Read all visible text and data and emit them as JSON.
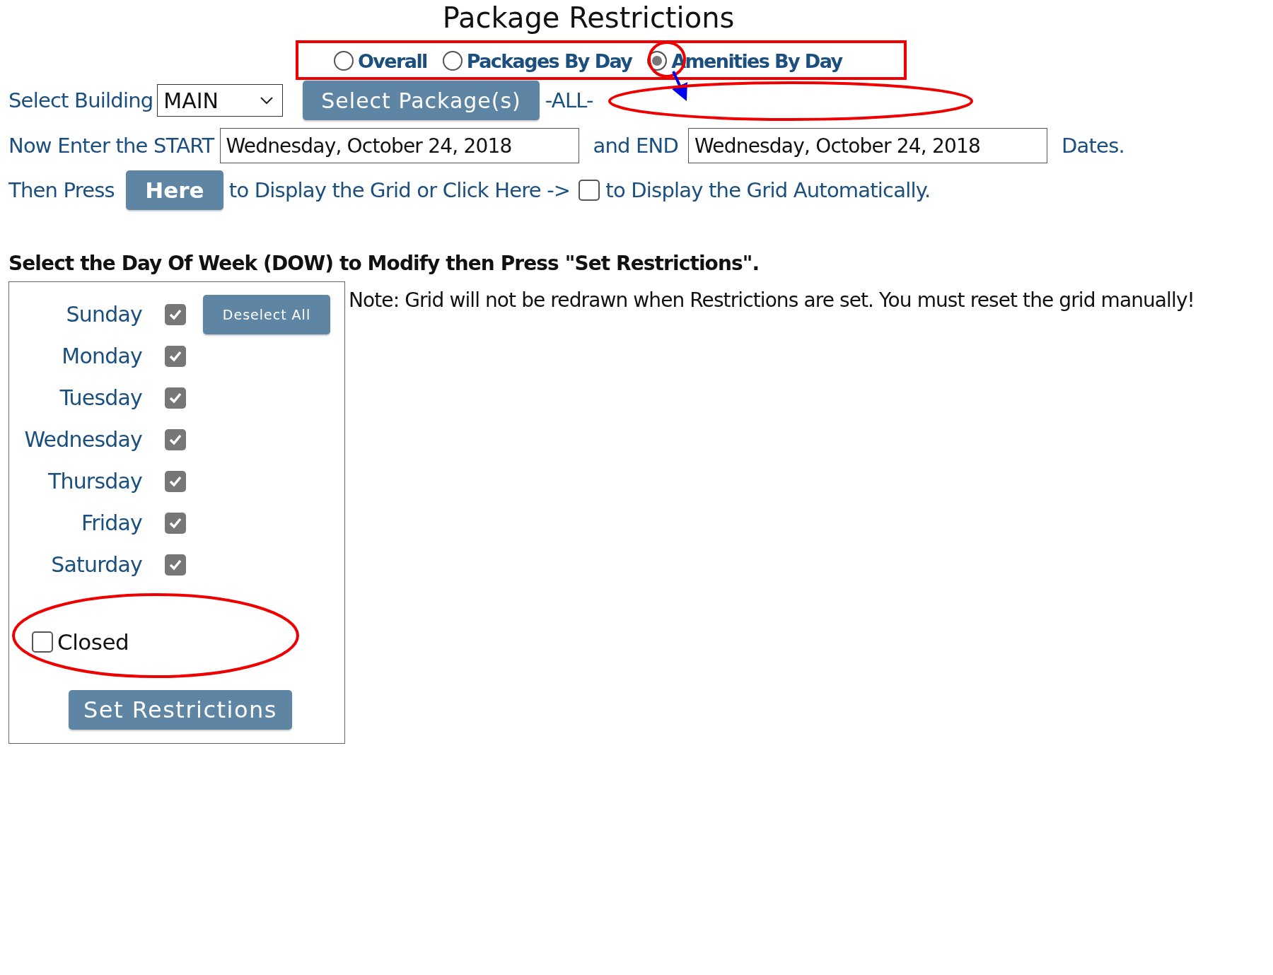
{
  "title": "Package Restrictions",
  "modes": [
    {
      "label": "Overall",
      "selected": false
    },
    {
      "label": "Packages By Day",
      "selected": false
    },
    {
      "label": "Amenities By Day",
      "selected": true
    }
  ],
  "building": {
    "label": "Select Building",
    "value": "MAIN"
  },
  "select_packages_button": "Select Package(s)",
  "packages_value": "-ALL-",
  "dates": {
    "start_label": "Now Enter the START",
    "start_value": "Wednesday, October 24, 2018",
    "end_label": "and END",
    "end_value": "Wednesday, October 24, 2018",
    "suffix": "Dates."
  },
  "display": {
    "prefix": "Then Press",
    "button": "Here",
    "middle": "to Display the Grid or Click Here ->",
    "auto_checked": false,
    "suffix": "to Display the Grid Automatically."
  },
  "dow_heading": "Select the Day Of Week (DOW) to Modify then Press \"Set Restrictions\".",
  "days": [
    {
      "name": "Sunday",
      "checked": true
    },
    {
      "name": "Monday",
      "checked": true
    },
    {
      "name": "Tuesday",
      "checked": true
    },
    {
      "name": "Wednesday",
      "checked": true
    },
    {
      "name": "Thursday",
      "checked": true
    },
    {
      "name": "Friday",
      "checked": true
    },
    {
      "name": "Saturday",
      "checked": true
    }
  ],
  "deselect_button": "Deselect All",
  "closed": {
    "label": "Closed",
    "checked": false
  },
  "set_button": "Set Restrictions",
  "note": "Note: Grid will not be redrawn when Restrictions are set. You must reset the grid manually!"
}
